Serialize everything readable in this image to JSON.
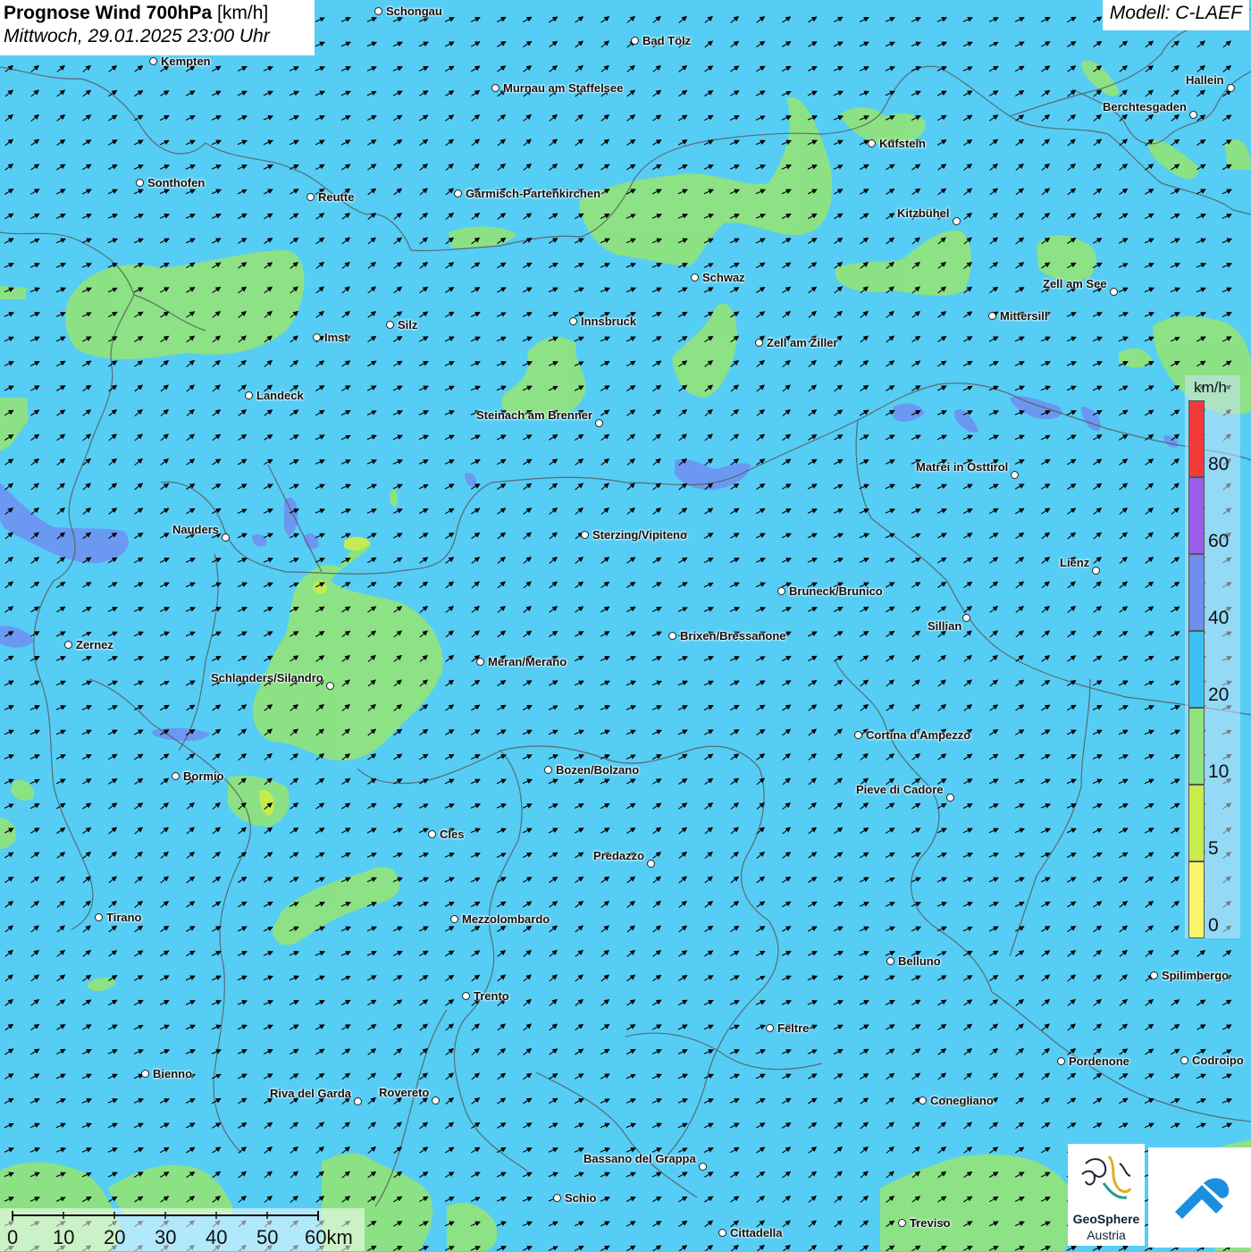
{
  "header": {
    "title": "Prognose Wind 700hPa",
    "unit": "[km/h]",
    "datetime": "Mittwoch, 29.01.2025 23:00 Uhr",
    "model": "Modell: C-LAEF"
  },
  "colors": {
    "background_wind_20_40": "#56cdf5",
    "wind_10_20": "#8fe37e",
    "wind_5_10": "#c8ec4c",
    "wind_40_60": "#6e8ef0",
    "wind_60_80": "#9a5ee8",
    "wind_80_plus": "#f23a3a",
    "wind_0_5": "#f8f56a",
    "border": "#555555"
  },
  "cities": [
    {
      "name": "Schongau",
      "dot": [
        424,
        13
      ]
    },
    {
      "name": "Bad Tölz",
      "dot": [
        711,
        46
      ]
    },
    {
      "name": "Kempten",
      "dot": [
        172,
        69
      ]
    },
    {
      "name": "Murnau am Staffelsee",
      "dot": [
        555,
        99
      ]
    },
    {
      "name": "Hallein",
      "dot": [
        1378,
        99
      ]
    },
    {
      "name": "Berchtesgaden",
      "dot": [
        1336,
        129
      ]
    },
    {
      "name": "Kufstein",
      "dot": [
        976,
        161
      ]
    },
    {
      "name": "Sonthofen",
      "dot": [
        157,
        205
      ]
    },
    {
      "name": "Reutte",
      "dot": [
        348,
        221
      ]
    },
    {
      "name": "Garmisch-Partenkirchen",
      "dot": [
        513,
        217
      ]
    },
    {
      "name": "Kitzbühel",
      "dot": [
        1071,
        248
      ]
    },
    {
      "name": "Schwaz",
      "dot": [
        778,
        311
      ]
    },
    {
      "name": "Zell am See",
      "dot": [
        1247,
        327
      ]
    },
    {
      "name": "Mittersill",
      "dot": [
        1111,
        354
      ]
    },
    {
      "name": "Innsbruck",
      "dot": [
        642,
        360
      ]
    },
    {
      "name": "Silz",
      "dot": [
        437,
        364
      ]
    },
    {
      "name": "Imst",
      "dot": [
        355,
        378
      ]
    },
    {
      "name": "Zell am Ziller",
      "dot": [
        850,
        384
      ]
    },
    {
      "name": "Landeck",
      "dot": [
        279,
        443
      ]
    },
    {
      "name": "Steinach am Brenner",
      "dot": [
        671,
        474
      ]
    },
    {
      "name": "Matrei in Osttirol",
      "dot": [
        1136,
        532
      ]
    },
    {
      "name": "Nauders",
      "dot": [
        253,
        602
      ]
    },
    {
      "name": "Sterzing/Vipiteno",
      "dot": [
        655,
        599
      ]
    },
    {
      "name": "Lienz",
      "dot": [
        1227,
        639
      ]
    },
    {
      "name": "Bruneck/Brunico",
      "dot": [
        875,
        662
      ]
    },
    {
      "name": "Sillian",
      "dot": [
        1082,
        692
      ]
    },
    {
      "name": "Brixen/Bressanone",
      "dot": [
        753,
        712
      ]
    },
    {
      "name": "Zernez",
      "dot": [
        77,
        722
      ]
    },
    {
      "name": "Meran/Merano",
      "dot": [
        538,
        741
      ]
    },
    {
      "name": "Schlanders/Silandro",
      "dot": [
        370,
        768
      ]
    },
    {
      "name": "Cortina d'Ampezzo",
      "dot": [
        961,
        823
      ]
    },
    {
      "name": "Bozen/Bolzano",
      "dot": [
        614,
        862
      ]
    },
    {
      "name": "Bormio",
      "dot": [
        197,
        869
      ]
    },
    {
      "name": "Pieve di Cadore",
      "dot": [
        1064,
        893
      ]
    },
    {
      "name": "Cles",
      "dot": [
        484,
        934
      ]
    },
    {
      "name": "Predazzo",
      "dot": [
        729,
        967
      ]
    },
    {
      "name": "Tirano",
      "dot": [
        111,
        1027
      ]
    },
    {
      "name": "Mezzolombardo",
      "dot": [
        509,
        1029
      ]
    },
    {
      "name": "Belluno",
      "dot": [
        997,
        1076
      ]
    },
    {
      "name": "Spilimbergo",
      "dot": [
        1292,
        1092
      ]
    },
    {
      "name": "Trento",
      "dot": [
        522,
        1115
      ]
    },
    {
      "name": "Feltre",
      "dot": [
        862,
        1151
      ]
    },
    {
      "name": "Pordenone",
      "dot": [
        1188,
        1188
      ]
    },
    {
      "name": "Codroipo",
      "dot": [
        1326,
        1187
      ]
    },
    {
      "name": "Bienno",
      "dot": [
        163,
        1202
      ]
    },
    {
      "name": "Riva del Garda",
      "dot": [
        401,
        1233
      ]
    },
    {
      "name": "Rovereto",
      "dot": [
        488,
        1232
      ]
    },
    {
      "name": "Conegliano",
      "dot": [
        1033,
        1232
      ]
    },
    {
      "name": "Bassano del Grappa",
      "dot": [
        787,
        1306
      ]
    },
    {
      "name": "Schio",
      "dot": [
        624,
        1341
      ]
    },
    {
      "name": "Treviso",
      "dot": [
        1010,
        1369
      ]
    },
    {
      "name": "Cittadella",
      "dot": [
        809,
        1380
      ]
    }
  ],
  "legend": {
    "unit": "km/h",
    "ticks": [
      "80",
      "60",
      "40",
      "20",
      "10",
      "5",
      "0"
    ]
  },
  "scalebar": {
    "labels": [
      "0",
      "10",
      "20",
      "30",
      "40",
      "50",
      "60km"
    ]
  },
  "logos": {
    "geosphere_line1": "GeoSphere",
    "geosphere_line2": "Austria"
  }
}
